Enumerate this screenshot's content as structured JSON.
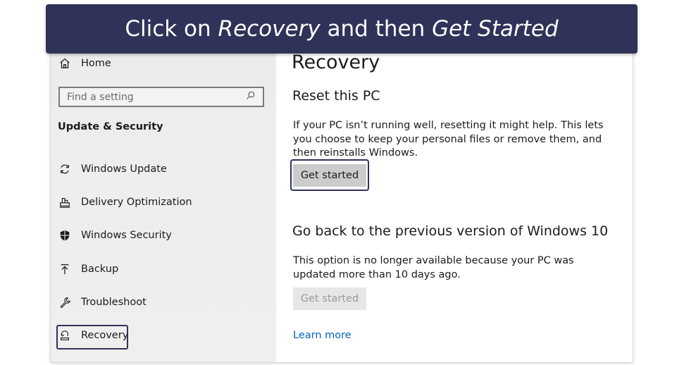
{
  "banner": {
    "part1": "Click on ",
    "part2": "Recovery",
    "part3": " and then ",
    "part4": "Get Started"
  },
  "sidebar": {
    "home": {
      "label": "Home",
      "icon": "home-icon"
    },
    "search": {
      "placeholder": "Find a setting",
      "icon": "search-icon"
    },
    "section_title": "Update & Security",
    "items": [
      {
        "label": "Windows Update",
        "icon": "refresh-icon"
      },
      {
        "label": "Delivery Optimization",
        "icon": "delivery-optimization-icon"
      },
      {
        "label": "Windows Security",
        "icon": "shield-icon"
      },
      {
        "label": "Backup",
        "icon": "backup-arrow-icon"
      },
      {
        "label": "Troubleshoot",
        "icon": "wrench-icon"
      },
      {
        "label": "Recovery",
        "icon": "recovery-icon"
      }
    ]
  },
  "main": {
    "title": "Recovery",
    "reset": {
      "heading": "Reset this PC",
      "description": "If your PC isn’t running well, resetting it might help. This lets you choose to keep your personal files or remove them, and then reinstalls Windows.",
      "button": "Get started"
    },
    "go_back": {
      "heading": "Go back to the previous version of Windows 10",
      "description": "This option is no longer available because your PC was updated more than 10 days ago.",
      "button": "Get started"
    },
    "learn_more": "Learn more"
  },
  "colors": {
    "banner_bg": "#2f3359",
    "highlight": "#2e3358",
    "link": "#0067b8"
  }
}
